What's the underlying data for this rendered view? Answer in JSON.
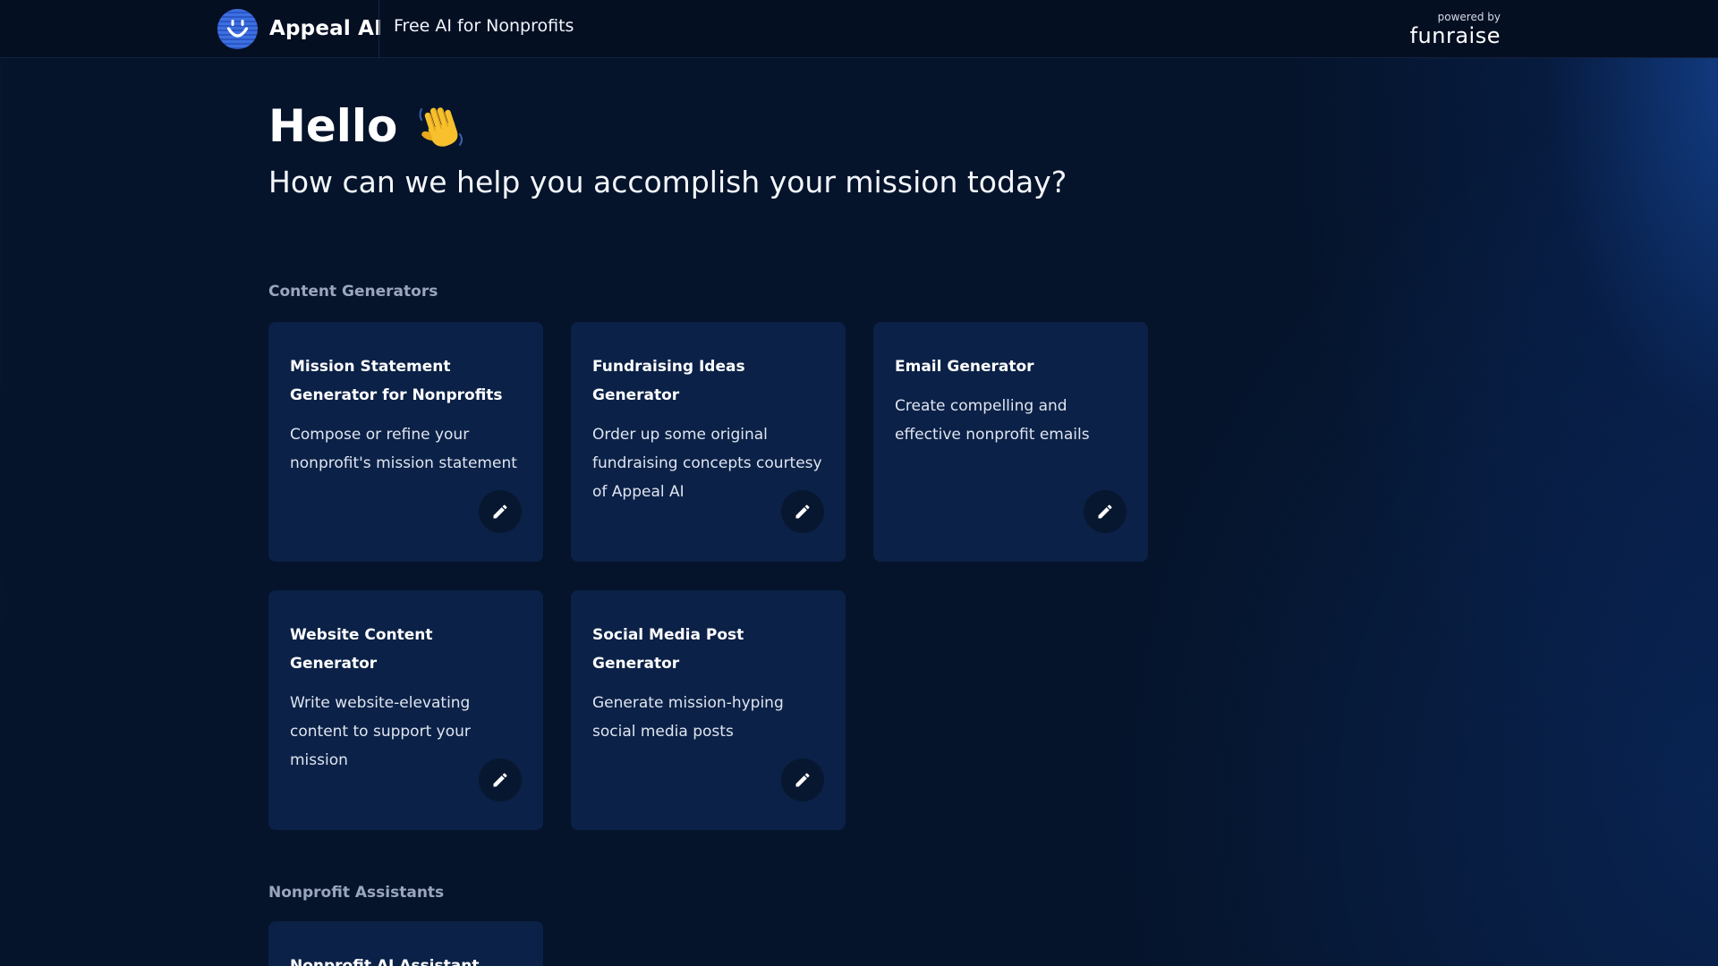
{
  "header": {
    "brand_name": "Appeal AI",
    "tagline": "Free AI for Nonprofits",
    "powered_by_label": "powered by",
    "powered_by_name": "funraise"
  },
  "hero": {
    "greeting": "Hello",
    "subtitle": "How can we help you accomplish your mission today?"
  },
  "sections": {
    "content_generators": {
      "label": "Content Generators",
      "cards": [
        {
          "title": "Mission Statement Generator for Nonprofits",
          "description": "Compose or refine your nonprofit's mission statement"
        },
        {
          "title": "Fundraising Ideas Generator",
          "description": "Order up some original fundraising concepts courtesy of Appeal AI"
        },
        {
          "title": "Email Generator",
          "description": "Create compelling and effective nonprofit emails"
        },
        {
          "title": "Website Content Generator",
          "description": "Write website-elevating content to support your mission"
        },
        {
          "title": "Social Media Post Generator",
          "description": "Generate mission-hyping social media posts"
        }
      ]
    },
    "nonprofit_assistants": {
      "label": "Nonprofit Assistants",
      "cards": [
        {
          "title": "Nonprofit AI Assistant"
        }
      ]
    }
  },
  "icons": {
    "logo": "smiley-logo-icon",
    "wave": "waving-hand-icon",
    "edit": "pencil-icon"
  },
  "colors": {
    "background": "#05142b",
    "card": "#0b2147",
    "accent": "#3d6fe0",
    "muted_label": "#9aa6bd"
  }
}
